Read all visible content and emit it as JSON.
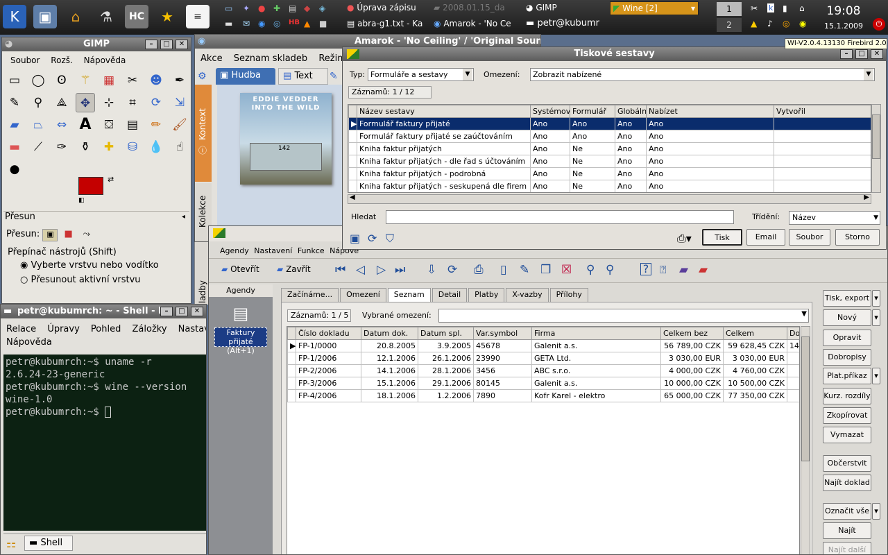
{
  "panel": {
    "launchers": [
      "kde-icon",
      "desktop-icon",
      "home-icon",
      "wine-tap-icon",
      "hc-icon",
      "star-icon",
      "document-icon"
    ],
    "tasks_row1": [
      "Úprava zápisu",
      "2008.01.15_da",
      "GIMP"
    ],
    "tasks_row2": [
      "abra-g1.txt - Ka",
      "Amarok - 'No Ce",
      "petr@kubumr"
    ],
    "wine_label": "Wine [2]",
    "pager": [
      "1",
      "2"
    ],
    "clock_time": "19:08",
    "clock_date": "15.1.2009"
  },
  "gimp": {
    "title": "GIMP",
    "menu": [
      "Soubor",
      "Rozš.",
      "Nápověda"
    ],
    "fg_color": "#c40000",
    "bg_color": "#ffffff",
    "section_title": "Přesun",
    "move_label": "Přesun:",
    "toggle_label": "Přepínač nástrojů  (Shift)",
    "radio1": "Vyberte vrstvu nebo vodítko",
    "radio2": "Přesunout aktivní vrstvu"
  },
  "amarok": {
    "title": "Amarok - 'No Ceiling' / 'Original Soundtrack'",
    "menu": [
      "Akce",
      "Seznam skladeb",
      "Režim"
    ],
    "tab_music": "Hudba",
    "tab_text": "Text",
    "side_context": "Kontext",
    "side_collection": "Kolekce",
    "side_playlists": "ladby",
    "album_artist": "EDDIE VEDDER",
    "album_title": "INTO THE WILD",
    "album_bus": "142"
  },
  "tooltip": "WI-V2.0.4.13130 Firebird 2.0",
  "reports": {
    "title": "Tiskové sestavy",
    "type_label": "Typ:",
    "type_value": "Formuláře a sestavy",
    "restrict_label": "Omezení:",
    "restrict_value": "Zobrazit nabízené",
    "records": "Záznamů:  1 / 12",
    "columns": [
      "Název sestavy",
      "Systémová",
      "Formulář",
      "Globální",
      "Nabízet",
      "Vytvořil"
    ],
    "rows": [
      [
        "Formulář faktury přijaté",
        "Ano",
        "Ano",
        "Ano",
        "Ano",
        ""
      ],
      [
        "Formulář faktury přijaté se zaúčtováním",
        "Ano",
        "Ano",
        "Ano",
        "Ano",
        ""
      ],
      [
        "Kniha faktur přijatých",
        "Ano",
        "Ne",
        "Ano",
        "Ano",
        ""
      ],
      [
        "Kniha faktur přijatých - dle řad s účtováním",
        "Ano",
        "Ne",
        "Ano",
        "Ano",
        ""
      ],
      [
        "Kniha faktur přijatých - podrobná",
        "Ano",
        "Ne",
        "Ano",
        "Ano",
        ""
      ],
      [
        "Kniha faktur přijatých - seskupená dle firem",
        "Ano",
        "Ne",
        "Ano",
        "Ano",
        ""
      ]
    ],
    "search_label": "Hledat",
    "sort_label": "Třídění:",
    "sort_value": "Název",
    "btn_print": "Tisk",
    "btn_email": "Email",
    "btn_file": "Soubor",
    "btn_cancel": "Storno"
  },
  "abra": {
    "menu": [
      "Agendy",
      "Nastavení",
      "Funkce",
      "Nápově"
    ],
    "btn_open": "Otevřít",
    "btn_close": "Zavřít",
    "agendy_header": "Agendy",
    "agenda_item": "Faktury přijaté (Alt+1)",
    "tabs": [
      "Začínáme...",
      "Omezení",
      "Seznam",
      "Detail",
      "Platby",
      "X-vazby",
      "Přílohy"
    ],
    "active_tab": "Seznam",
    "records": "Záznamů:  1 / 5",
    "filter_label": "Vybrané omezení:",
    "columns": [
      "Číslo dokladu",
      "Datum dok.",
      "Datum spl.",
      "Var.symbol",
      "Firma",
      "Celkem bez",
      "Celkem",
      "Dob"
    ],
    "rows": [
      [
        "FP-1/0000",
        "20.8.2005",
        "3.9.2005",
        "45678",
        "Galenit a.s.",
        "56 789,00 CZK",
        "59 628,45 CZK",
        "14"
      ],
      [
        "FP-1/2006",
        "12.1.2006",
        "26.1.2006",
        "23990",
        "GETA Ltd.",
        "3 030,00 EUR",
        "3 030,00 EUR",
        ""
      ],
      [
        "FP-2/2006",
        "14.1.2006",
        "28.1.2006",
        "3456",
        "ABC s.r.o.",
        "4 000,00 CZK",
        "4 760,00 CZK",
        ""
      ],
      [
        "FP-3/2006",
        "15.1.2006",
        "29.1.2006",
        "80145",
        "Galenit a.s.",
        "10 000,00 CZK",
        "10 500,00 CZK",
        ""
      ],
      [
        "FP-4/2006",
        "18.1.2006",
        "1.2.2006",
        "7890",
        "Kofr Karel - elektro",
        "65 000,00 CZK",
        "77 350,00 CZK",
        ""
      ]
    ],
    "side_buttons": [
      "Tisk, export",
      "Nový",
      "Opravit",
      "Dobropisy",
      "Plat.příkaz",
      "Kurz. rozdíly",
      "Zkopírovat",
      "Vymazat",
      "Občerstvit",
      "Najít doklad",
      "Označit vše",
      "Najít",
      "Najít další"
    ]
  },
  "konsole": {
    "title": "petr@kubumrch: ~ - Shell - K",
    "menu1": [
      "Relace",
      "Úpravy",
      "Pohled",
      "Záložky",
      "Nastaven"
    ],
    "menu2": [
      "Nápověda"
    ],
    "lines": [
      "petr@kubumrch:~$ uname -r",
      "2.6.24-23-generic",
      "petr@kubumrch:~$ wine --version",
      "wine-1.0",
      "petr@kubumrch:~$ "
    ],
    "tab_label": "Shell"
  }
}
